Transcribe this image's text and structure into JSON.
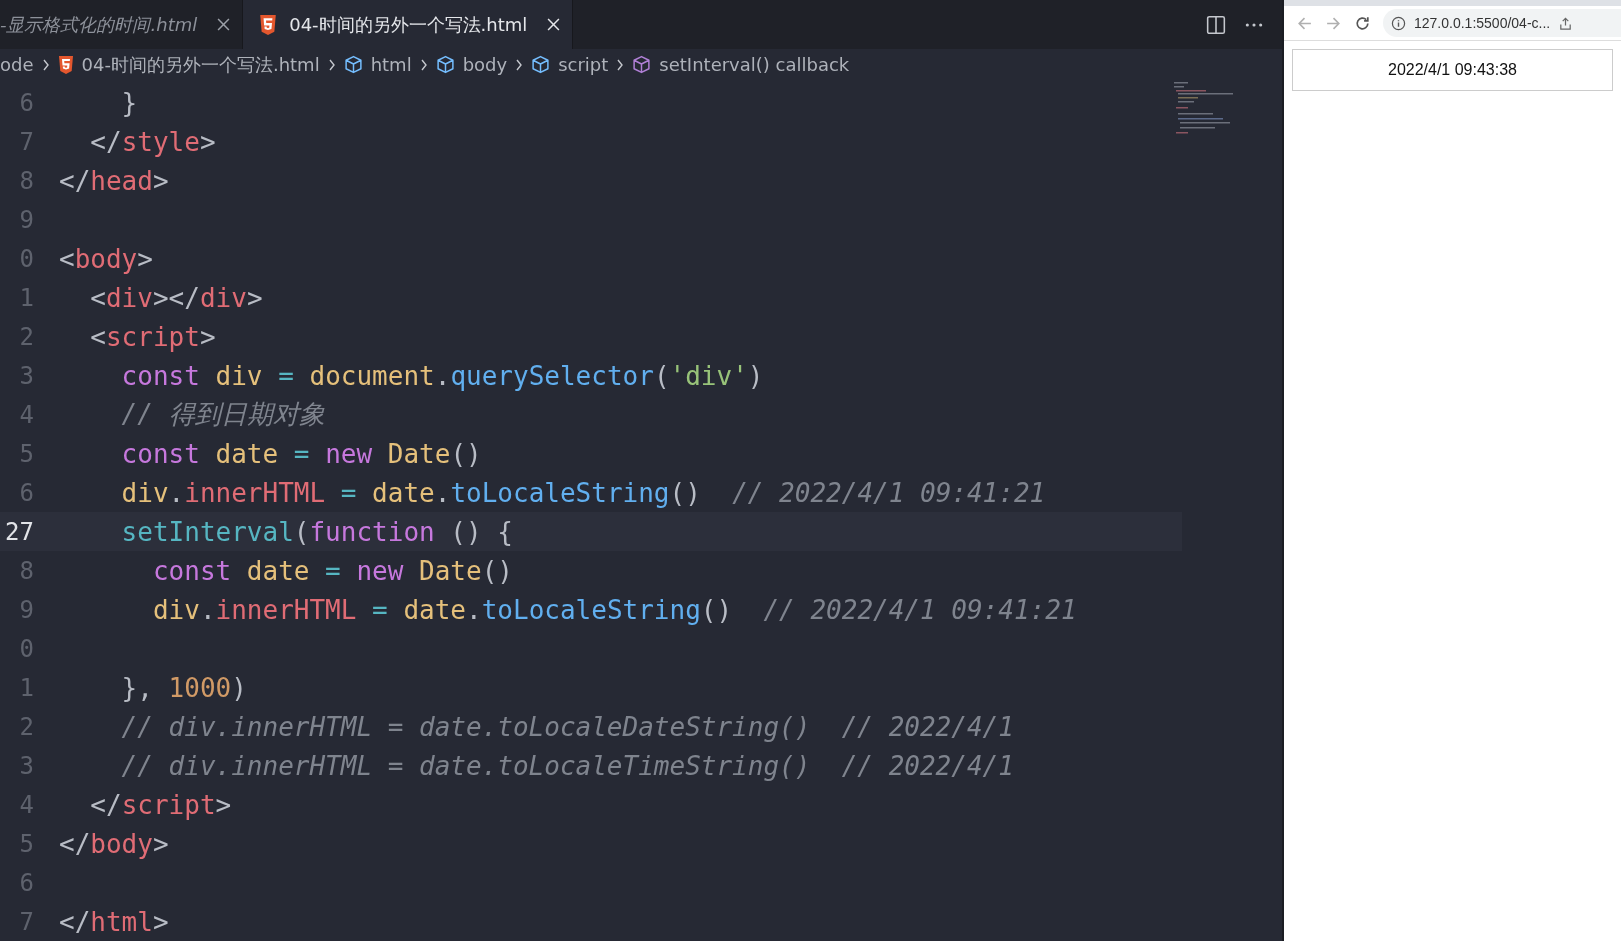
{
  "tabs": [
    {
      "label": "-显示格式化的时间.html",
      "selected": false,
      "preview": true,
      "file_icon": false
    },
    {
      "label": "04-时间的另外一个写法.html",
      "selected": true,
      "preview": false,
      "file_icon": true
    }
  ],
  "breadcrumb": [
    {
      "label": "ode",
      "kind": "text"
    },
    {
      "label": "04-时间的另外一个写法.html",
      "kind": "file"
    },
    {
      "label": "html",
      "kind": "tag"
    },
    {
      "label": "body",
      "kind": "tag"
    },
    {
      "label": "script",
      "kind": "tag"
    },
    {
      "label": "setInterval() callback",
      "kind": "method"
    }
  ],
  "lines": [
    {
      "number": "6",
      "current": false,
      "tokens": [
        {
          "kind": "punct",
          "text": "    }"
        }
      ]
    },
    {
      "number": "7",
      "current": false,
      "tokens": [
        {
          "kind": "punct",
          "text": "  </"
        },
        {
          "kind": "tag",
          "text": "style"
        },
        {
          "kind": "punct",
          "text": ">"
        }
      ]
    },
    {
      "number": "8",
      "current": false,
      "tokens": [
        {
          "kind": "punct",
          "text": "</"
        },
        {
          "kind": "tag",
          "text": "head"
        },
        {
          "kind": "punct",
          "text": ">"
        }
      ]
    },
    {
      "number": "9",
      "current": false
    },
    {
      "number": "0",
      "current": false,
      "tokens": [
        {
          "kind": "punct",
          "text": "<"
        },
        {
          "kind": "tag",
          "text": "body"
        },
        {
          "kind": "punct",
          "text": ">"
        }
      ]
    },
    {
      "number": "1",
      "current": false,
      "tokens": [
        {
          "kind": "punct",
          "text": "  <"
        },
        {
          "kind": "tag",
          "text": "div"
        },
        {
          "kind": "punct",
          "text": "></"
        },
        {
          "kind": "tag",
          "text": "div"
        },
        {
          "kind": "punct",
          "text": ">"
        }
      ]
    },
    {
      "number": "2",
      "current": false,
      "tokens": [
        {
          "kind": "punct",
          "text": "  <"
        },
        {
          "kind": "tag",
          "text": "script"
        },
        {
          "kind": "punct",
          "text": ">"
        }
      ]
    },
    {
      "number": "3",
      "current": false,
      "tokens": [
        {
          "kind": "keyword",
          "text": "    const"
        },
        {
          "kind": "var",
          "text": " div"
        },
        {
          "kind": "op",
          "text": " ="
        },
        {
          "kind": "var",
          "text": " document"
        },
        {
          "kind": "punct",
          "text": "."
        },
        {
          "kind": "func",
          "text": "querySelector"
        },
        {
          "kind": "punct",
          "text": "("
        },
        {
          "kind": "string",
          "text": "'div'"
        },
        {
          "kind": "punct",
          "text": ")"
        }
      ]
    },
    {
      "number": "4",
      "current": false,
      "tokens": [
        {
          "kind": "comment",
          "text": "    // 得到日期对象"
        }
      ]
    },
    {
      "number": "5",
      "current": false,
      "tokens": [
        {
          "kind": "keyword",
          "text": "    const"
        },
        {
          "kind": "var",
          "text": " date"
        },
        {
          "kind": "op",
          "text": " ="
        },
        {
          "kind": "keyword",
          "text": " new"
        },
        {
          "kind": "var",
          "text": " Date"
        },
        {
          "kind": "punct",
          "text": "()"
        }
      ]
    },
    {
      "number": "6",
      "current": false,
      "tokens": [
        {
          "kind": "var",
          "text": "    div"
        },
        {
          "kind": "punct",
          "text": "."
        },
        {
          "kind": "prop",
          "text": "innerHTML"
        },
        {
          "kind": "op",
          "text": " ="
        },
        {
          "kind": "var",
          "text": " date"
        },
        {
          "kind": "punct",
          "text": "."
        },
        {
          "kind": "func",
          "text": "toLocaleString"
        },
        {
          "kind": "punct",
          "text": "()"
        },
        {
          "kind": "comment",
          "text": "  // 2022/4/1 09:41:21"
        }
      ]
    },
    {
      "number": "27",
      "current": true,
      "tokens": [
        {
          "kind": "builtin",
          "text": "    setInterval"
        },
        {
          "kind": "punct",
          "text": "("
        },
        {
          "kind": "keyword",
          "text": "function"
        },
        {
          "kind": "punct",
          "text": " () {"
        }
      ]
    },
    {
      "number": "8",
      "current": false,
      "tokens": [
        {
          "kind": "keyword",
          "text": "      const"
        },
        {
          "kind": "var",
          "text": " date"
        },
        {
          "kind": "op",
          "text": " ="
        },
        {
          "kind": "keyword",
          "text": " new"
        },
        {
          "kind": "var",
          "text": " Date"
        },
        {
          "kind": "punct",
          "text": "()"
        }
      ]
    },
    {
      "number": "9",
      "current": false,
      "tokens": [
        {
          "kind": "var",
          "text": "      div"
        },
        {
          "kind": "punct",
          "text": "."
        },
        {
          "kind": "prop",
          "text": "innerHTML"
        },
        {
          "kind": "op",
          "text": " ="
        },
        {
          "kind": "var",
          "text": " date"
        },
        {
          "kind": "punct",
          "text": "."
        },
        {
          "kind": "func",
          "text": "toLocaleString"
        },
        {
          "kind": "punct",
          "text": "()"
        },
        {
          "kind": "comment",
          "text": "  // 2022/4/1 09:41:21"
        }
      ]
    },
    {
      "number": "0",
      "current": false
    },
    {
      "number": "1",
      "current": false,
      "tokens": [
        {
          "kind": "punct",
          "text": "    },"
        },
        {
          "kind": "number",
          "text": " 1000"
        },
        {
          "kind": "punct",
          "text": ")"
        }
      ]
    },
    {
      "number": "2",
      "current": false,
      "tokens": [
        {
          "kind": "comment",
          "text": "    // div.innerHTML = date.toLocaleDateString()  // 2022/4/1"
        }
      ]
    },
    {
      "number": "3",
      "current": false,
      "tokens": [
        {
          "kind": "comment",
          "text": "    // div.innerHTML = date.toLocaleTimeString()  // 2022/4/1"
        }
      ]
    },
    {
      "number": "4",
      "current": false,
      "tokens": [
        {
          "kind": "punct",
          "text": "  </"
        },
        {
          "kind": "tag",
          "text": "script"
        },
        {
          "kind": "punct",
          "text": ">"
        }
      ]
    },
    {
      "number": "5",
      "current": false,
      "tokens": [
        {
          "kind": "punct",
          "text": "</"
        },
        {
          "kind": "tag",
          "text": "body"
        },
        {
          "kind": "punct",
          "text": ">"
        }
      ]
    },
    {
      "number": "6",
      "current": false
    },
    {
      "number": "7",
      "current": false,
      "tokens": [
        {
          "kind": "punct",
          "text": "</"
        },
        {
          "kind": "tag",
          "text": "html"
        },
        {
          "kind": "punct",
          "text": ">"
        }
      ]
    }
  ],
  "browser": {
    "url": "127.0.0.1:5500/04-c...",
    "page_text": "2022/4/1 09:43:38"
  }
}
